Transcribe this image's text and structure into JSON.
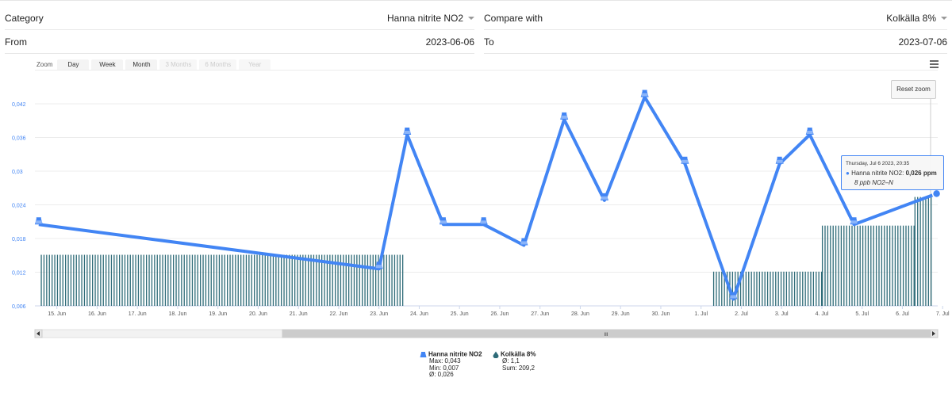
{
  "form": {
    "category_label": "Category",
    "category_value": "Hanna nitrite NO2",
    "compare_label": "Compare with",
    "compare_value": "Kolkälla 8%",
    "from_label": "From",
    "from_value": "2023-06-06",
    "to_label": "To",
    "to_value": "2023-07-06"
  },
  "zoom": {
    "label": "Zoom",
    "buttons": [
      {
        "label": "Day",
        "enabled": true
      },
      {
        "label": "Week",
        "enabled": true
      },
      {
        "label": "Month",
        "enabled": true
      },
      {
        "label": "3 Months",
        "enabled": false
      },
      {
        "label": "6 Months",
        "enabled": false
      },
      {
        "label": "Year",
        "enabled": false
      }
    ]
  },
  "reset_zoom_label": "Reset zoom",
  "tooltip": {
    "date": "Thursday, Jul 6 2023, 20:35",
    "series": "Hanna nitrite NO2:",
    "value": "0,026 ppm",
    "extra": "8 ppb NO2–N"
  },
  "legend": [
    {
      "name": "Hanna nitrite NO2",
      "stats": [
        "Max: 0,043",
        "Min: 0,007",
        "Ø: 0,026"
      ]
    },
    {
      "name": "Kolkälla 8%",
      "stats": [
        "Ø: 1,1",
        "Sum: 209,2"
      ]
    }
  ],
  "colors": {
    "line": "#4285f4",
    "bars": "#2e6b78",
    "icon": "#4285f4",
    "accent": "#4285f4"
  },
  "chart_data": {
    "type": "line",
    "x_ticks": [
      "15. Jun",
      "16. Jun",
      "17. Jun",
      "18. Jun",
      "19. Jun",
      "20. Jun",
      "21. Jun",
      "22. Jun",
      "23. Jun",
      "24. Jun",
      "25. Jun",
      "26. Jun",
      "27. Jun",
      "28. Jun",
      "29. Jun",
      "30. Jun",
      "1. Jul",
      "2. Jul",
      "3. Jul",
      "4. Jul",
      "5. Jul",
      "6. Jul",
      "7. Jul"
    ],
    "y_ticks": [
      "0,006",
      "0,012",
      "0,018",
      "0,024",
      "0,03",
      "0,036",
      "0,042"
    ],
    "ylim": [
      0.006,
      0.042
    ],
    "xlim_days": [
      14.5,
      37.1
    ],
    "series": [
      {
        "name": "Hanna nitrite NO2",
        "type": "line",
        "points": [
          {
            "x": 14.55,
            "y": 0.0205
          },
          {
            "x": 23.0,
            "y": 0.0126
          },
          {
            "x": 23.7,
            "y": 0.0365
          },
          {
            "x": 24.6,
            "y": 0.0205
          },
          {
            "x": 25.6,
            "y": 0.0205
          },
          {
            "x": 26.6,
            "y": 0.0168
          },
          {
            "x": 27.6,
            "y": 0.0392
          },
          {
            "x": 28.6,
            "y": 0.0248
          },
          {
            "x": 29.6,
            "y": 0.0432
          },
          {
            "x": 30.6,
            "y": 0.0313
          },
          {
            "x": 31.8,
            "y": 0.0072
          },
          {
            "x": 32.95,
            "y": 0.0313
          },
          {
            "x": 33.7,
            "y": 0.0365
          },
          {
            "x": 34.8,
            "y": 0.0205
          },
          {
            "x": 36.85,
            "y": 0.026
          }
        ]
      },
      {
        "name": "Kolkälla 8%",
        "type": "column",
        "segments": [
          {
            "from": 14.6,
            "to": 23.6,
            "y": 0.0151
          },
          {
            "from": 31.3,
            "to": 34.0,
            "y": 0.0121
          },
          {
            "from": 34.0,
            "to": 36.3,
            "y": 0.0203
          },
          {
            "from": 36.3,
            "to": 37.1,
            "y": 0.0254
          }
        ]
      }
    ],
    "navigator": {
      "scroll_label": "III"
    }
  }
}
